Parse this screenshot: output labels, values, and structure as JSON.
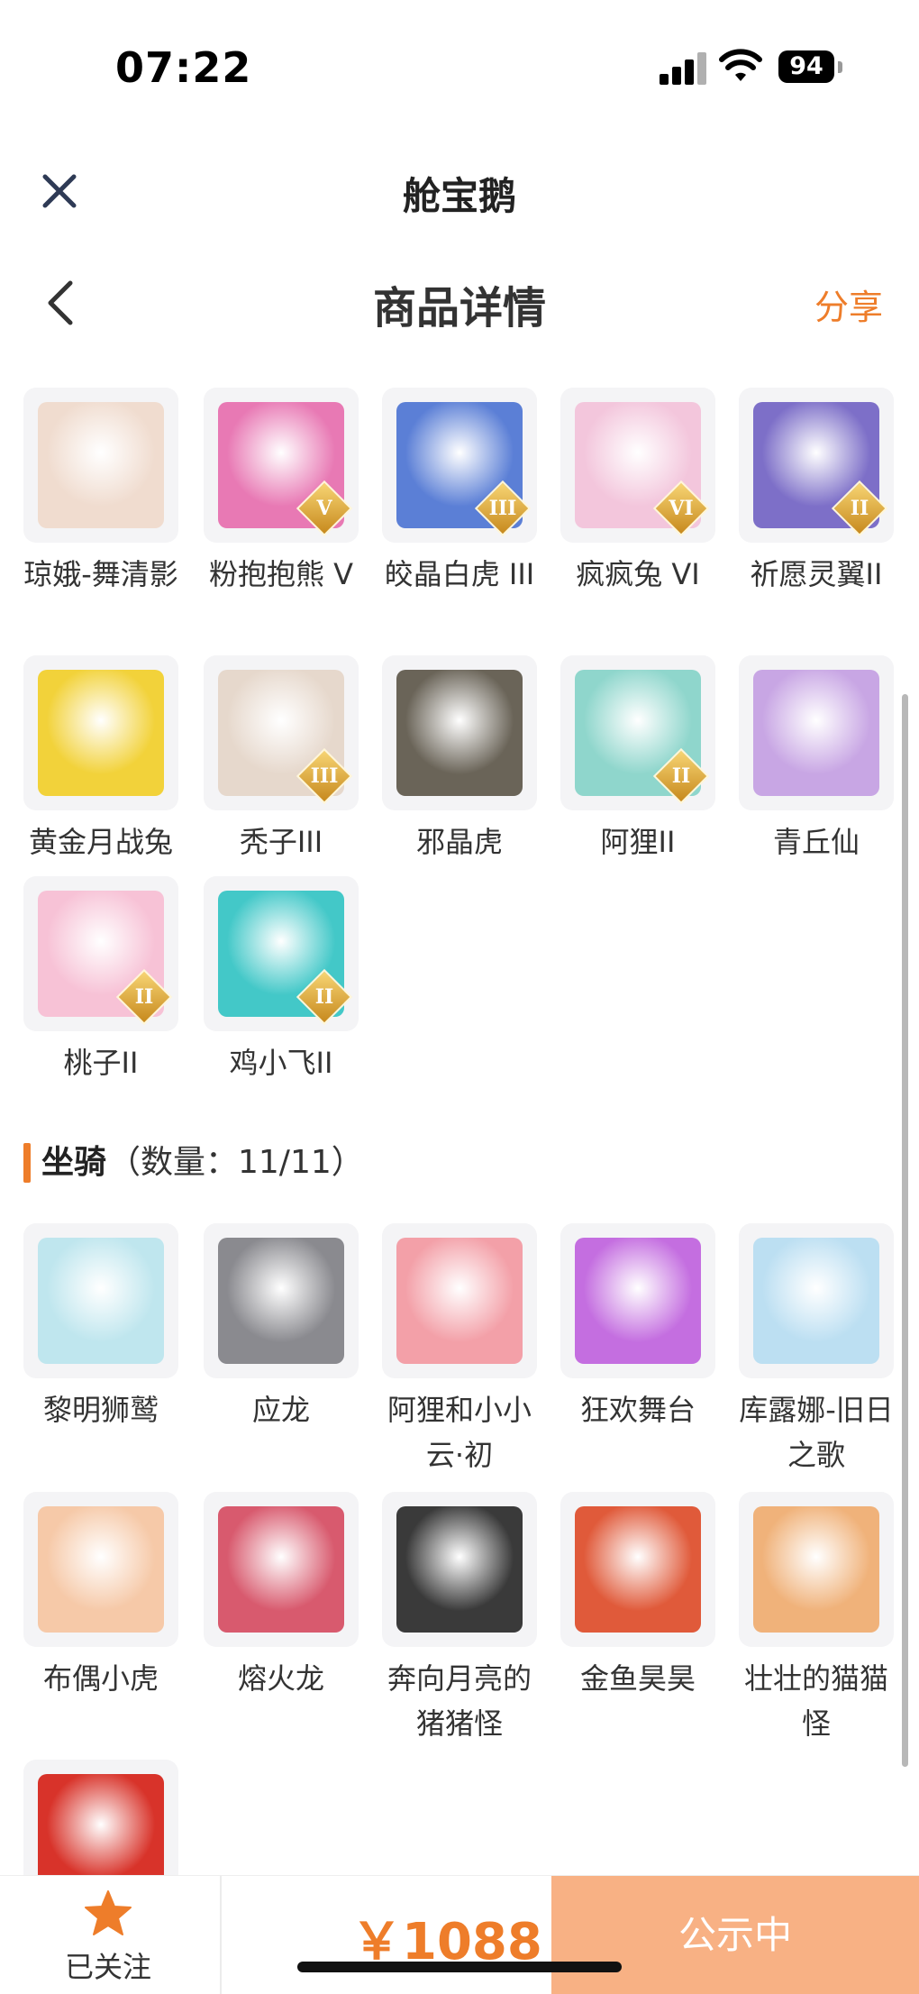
{
  "status_bar": {
    "time": "07:22",
    "battery": "94"
  },
  "mini_program": {
    "title": "舱宝鹅"
  },
  "nav": {
    "title": "商品详情",
    "share": "分享"
  },
  "pets": [
    {
      "name": "琼娥-舞清影",
      "badge": "",
      "color": "#f0dccf"
    },
    {
      "name": "粉抱抱熊 V",
      "badge": "V",
      "color": "#e879b4"
    },
    {
      "name": "皎晶白虎 III",
      "badge": "III",
      "color": "#5b7fd6"
    },
    {
      "name": "疯疯兔 VI",
      "badge": "VI",
      "color": "#f3c6dc"
    },
    {
      "name": "祈愿灵翼II",
      "badge": "II",
      "color": "#7d6fc8"
    },
    {
      "name": "黄金月战兔",
      "badge": "",
      "color": "#f2d23a"
    },
    {
      "name": "秃子III",
      "badge": "III",
      "color": "#e6d8cc"
    },
    {
      "name": "邪晶虎",
      "badge": "",
      "color": "#6a6458"
    },
    {
      "name": "阿狸II",
      "badge": "II",
      "color": "#8fd6cc"
    },
    {
      "name": "青丘仙",
      "badge": "",
      "color": "#c8a6e4"
    },
    {
      "name": "桃子II",
      "badge": "II",
      "color": "#f7c2d6"
    },
    {
      "name": "鸡小飞II",
      "badge": "II",
      "color": "#43c8c8"
    }
  ],
  "mount_section": {
    "title": "坐骑",
    "count": "（数量：11/11）"
  },
  "mounts": [
    {
      "name": "黎明狮鹫",
      "color": "#bfe6ee"
    },
    {
      "name": "应龙",
      "color": "#8a8a8f"
    },
    {
      "name": "阿狸和小小云·初",
      "color": "#f3a0a8"
    },
    {
      "name": "狂欢舞台",
      "color": "#c46ee0"
    },
    {
      "name": "库露娜-旧日之歌",
      "color": "#bcdff2"
    },
    {
      "name": "布偶小虎",
      "color": "#f6c9a8"
    },
    {
      "name": "熔火龙",
      "color": "#d85a6e"
    },
    {
      "name": "奔向月亮的猪猪怪",
      "color": "#3a3a3a"
    },
    {
      "name": "金鱼昊昊",
      "color": "#e05a3a"
    },
    {
      "name": "壮壮的猫猫怪",
      "color": "#f0b27a"
    },
    {
      "name": "",
      "color": "#d8332a"
    }
  ],
  "bottom": {
    "follow_label": "已关注",
    "price": "￥1088",
    "status_button": "公示中"
  },
  "colors": {
    "accent": "#ee7d2a",
    "button_bg": "#f8b184"
  }
}
